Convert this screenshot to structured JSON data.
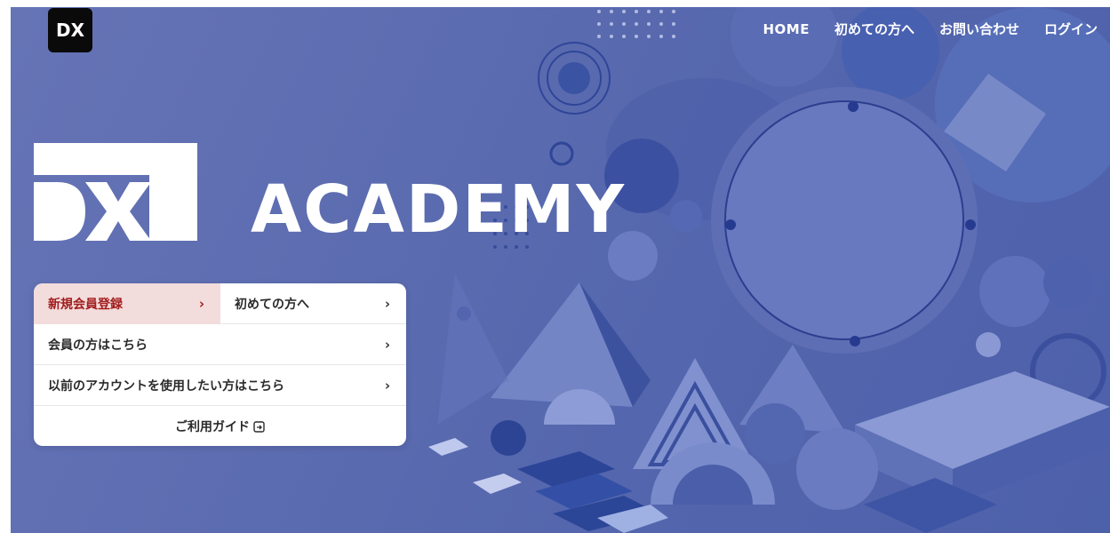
{
  "header": {
    "logo_text": "DX",
    "nav": [
      {
        "label": "HOME"
      },
      {
        "label": "初めての方へ"
      },
      {
        "label": "お問い合わせ"
      },
      {
        "label": "ログイン"
      }
    ]
  },
  "hero": {
    "brand_word": "ACADEMY",
    "brand_mark_text": "DX"
  },
  "menu": {
    "register_label": "新規会員登録",
    "first_time_label": "初めての方へ",
    "member_label": "会員の方はこちら",
    "previous_account_label": "以前のアカウントを使用したい方はこちら",
    "guide_label": "ご利用ガイド",
    "chevron": "›"
  },
  "colors": {
    "hero_blue": "#5c6cb0",
    "register_bg": "#f2dcdc",
    "register_text": "#a21c1c"
  }
}
